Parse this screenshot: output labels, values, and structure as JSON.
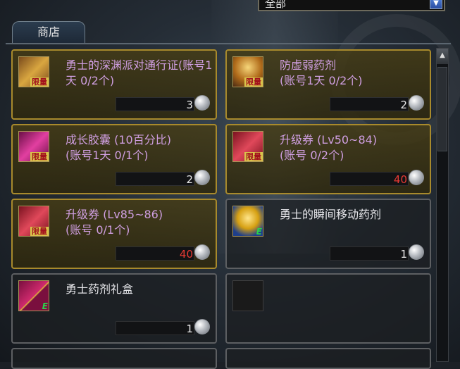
{
  "filter": {
    "selected": "全部"
  },
  "tab": {
    "label": "商店"
  },
  "items": [
    {
      "name": "勇士的深渊派对通行证(账号1天 0/2个)",
      "price": "3",
      "badge": "限量",
      "price_color": "white"
    },
    {
      "name": "防虚弱药剂\n(账号1天 0/2个)",
      "price": "2",
      "badge": "限量",
      "price_color": "white"
    },
    {
      "name": "成长胶囊 (10百分比)\n(账号1天 0/1个)",
      "price": "2",
      "badge": "限量",
      "price_color": "white"
    },
    {
      "name": "升级券 (Lv50~84)\n(账号 0/2个)",
      "price": "40",
      "badge": "限量",
      "price_color": "red"
    },
    {
      "name": "升级券 (Lv85~86)\n(账号 0/1个)",
      "price": "40",
      "badge": "限量",
      "price_color": "red"
    },
    {
      "name": "勇士的瞬间移动药剂",
      "price": "1",
      "badge": "E",
      "price_color": "white"
    },
    {
      "name": "勇士药剂礼盒",
      "price": "1",
      "badge": "E",
      "price_color": "white"
    }
  ],
  "colors": {
    "limited_border": "#a88a2c",
    "name_purple": "#d09fe2",
    "price_red": "#e83a34"
  }
}
